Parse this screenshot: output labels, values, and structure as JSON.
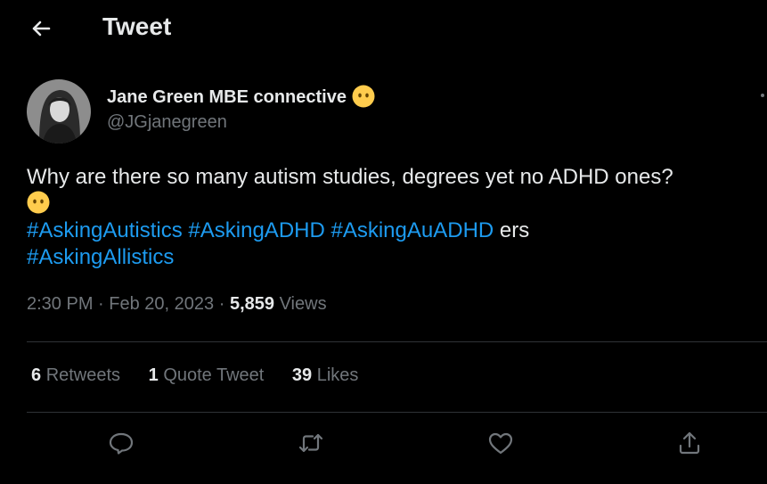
{
  "header": {
    "title": "Tweet",
    "back_icon": "arrow-left-icon"
  },
  "author": {
    "name": "Jane Green MBE connective",
    "handle": "@JGjanegreen",
    "avatar_icon": "avatar",
    "emoji_icon": "speechless-face-emoji-icon"
  },
  "tweet": {
    "line1": "Why are there so many autism studies, degrees yet no ADHD ones?",
    "hashtags": [
      "#AskingAutistics",
      "#AskingADHD",
      "#AskingAuADHD",
      "#AskingAllistics"
    ],
    "trailing_text": " ers"
  },
  "meta": {
    "time": "2:30 PM",
    "separator": "·",
    "date": "Feb 20, 2023",
    "views_count": "5,859",
    "views_label": "Views"
  },
  "stats": {
    "retweets_count": "6",
    "retweets_label": "Retweets",
    "quotes_count": "1",
    "quotes_label": "Quote Tweet",
    "likes_count": "39",
    "likes_label": "Likes"
  },
  "actions": [
    "reply-icon",
    "retweet-icon",
    "like-icon",
    "share-icon"
  ],
  "colors": {
    "background": "#000000",
    "text": "#e7e9ea",
    "secondary": "#71767b",
    "link": "#1d9bf0",
    "divider": "#2f3336",
    "emoji": "#ffcc4d"
  }
}
